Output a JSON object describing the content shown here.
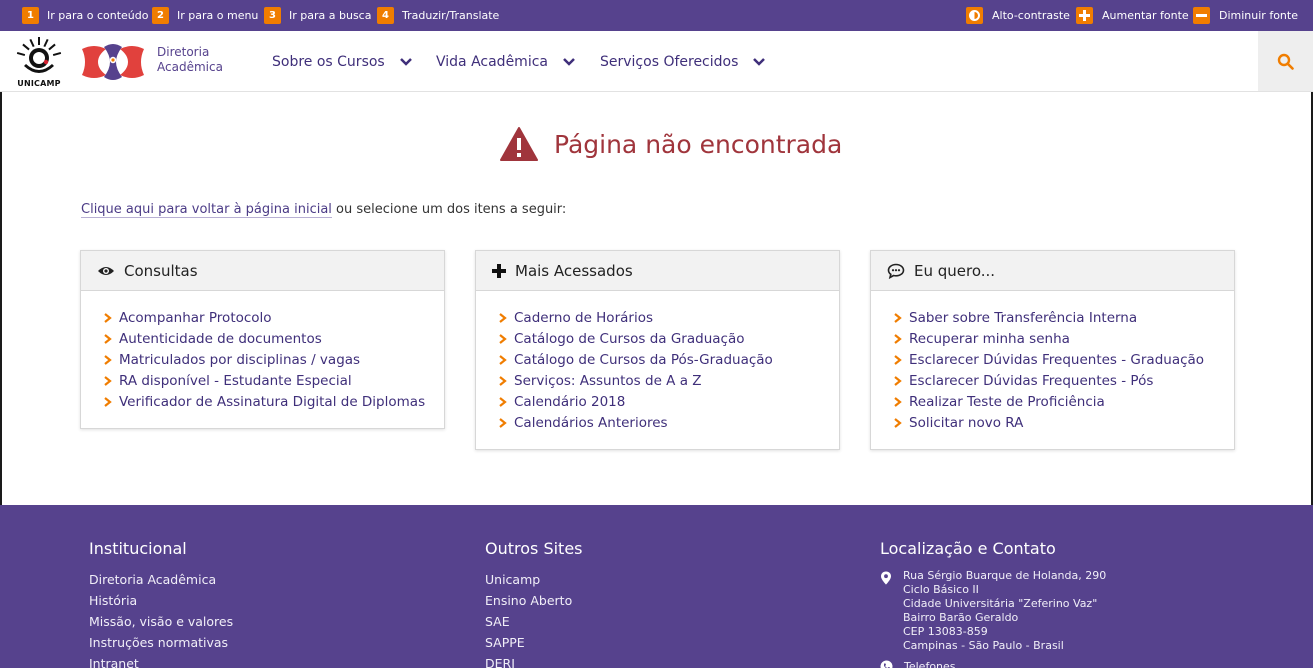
{
  "accessibility_bar": {
    "skip_links": [
      {
        "number": "1",
        "label": "Ir para o conteúdo"
      },
      {
        "number": "2",
        "label": "Ir para o menu"
      },
      {
        "number": "3",
        "label": "Ir para a busca"
      },
      {
        "number": "4",
        "label": "Traduzir/Translate"
      }
    ],
    "high_contrast_label": "Alto-contraste",
    "increase_font_label": "Aumentar fonte",
    "decrease_font_label": "Diminuir fonte"
  },
  "header": {
    "unicamp_logo_text": "UNICAMP",
    "site_name_line1": "Diretoria",
    "site_name_line2": "Acadêmica",
    "nav": [
      {
        "label": "Sobre os Cursos"
      },
      {
        "label": "Vida Acadêmica"
      },
      {
        "label": "Serviços Oferecidos"
      }
    ],
    "search_icon": "search-icon"
  },
  "main": {
    "error_title": "Página não encontrada",
    "intro_link": "Clique aqui para voltar à página inicial",
    "intro_text": " ou selecione um dos itens a seguir:",
    "cards": [
      {
        "title": "Consultas",
        "icon": "eye-icon",
        "items": [
          "Acompanhar Protocolo",
          "Autenticidade de documentos",
          "Matriculados por disciplinas / vagas",
          "RA disponível - Estudante Especial",
          "Verificador de Assinatura Digital de Diplomas"
        ]
      },
      {
        "title": "Mais Acessados",
        "icon": "plus-icon",
        "items": [
          "Caderno de Horários",
          "Catálogo de Cursos da Graduação",
          "Catálogo de Cursos da Pós-Graduação",
          "Serviços: Assuntos de A a Z",
          "Calendário 2018",
          "Calendários Anteriores"
        ]
      },
      {
        "title": "Eu quero...",
        "icon": "comment-icon",
        "items": [
          "Saber sobre Transferência Interna",
          "Recuperar minha senha",
          "Esclarecer Dúvidas Frequentes - Graduação",
          "Esclarecer Dúvidas Frequentes - Pós",
          "Realizar Teste de Proficiência",
          "Solicitar novo RA"
        ]
      }
    ]
  },
  "footer": {
    "institutional": {
      "title": "Institucional",
      "links": [
        "Diretoria Acadêmica",
        "História",
        "Missão, visão e valores",
        "Instruções normativas",
        "Intranet"
      ]
    },
    "other_sites": {
      "title": "Outros Sites",
      "links": [
        "Unicamp",
        "Ensino Aberto",
        "SAE",
        "SAPPE",
        "DERI"
      ]
    },
    "contact": {
      "title": "Localização e Contato",
      "address": [
        "Rua Sérgio Buarque de Holanda, 290",
        "Ciclo Básico II",
        "Cidade Universitária \"Zeferino Vaz\"",
        "Bairro Barão Geraldo",
        "CEP 13083-859",
        "Campinas - São Paulo - Brasil"
      ],
      "phone_label": "Telefones"
    }
  },
  "colors": {
    "brand_purple": "#56428d",
    "accent_orange": "#f07d00",
    "error_red": "#a0353c",
    "link_purple": "#3f2f7a"
  }
}
